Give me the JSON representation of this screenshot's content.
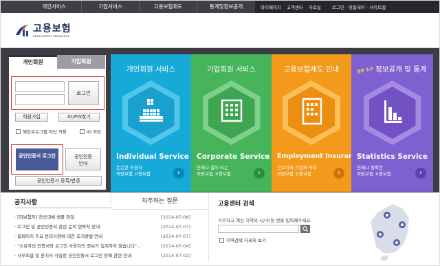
{
  "topnav": {
    "items": [
      "개인서비스",
      "기업서비스",
      "고용보험제도",
      "통계및정보공개"
    ],
    "util": [
      "마이페이지",
      "고객센터",
      "자료실",
      "로그인 · 맞춤제어 · 사이트맵"
    ]
  },
  "logo": {
    "title": "고용보험",
    "subtitle": "EMPLOYMENT INSURANCE"
  },
  "login": {
    "tab_personal": "개인회원",
    "tab_corporate": "기업회원",
    "login_button": "로그인",
    "join_button": "회원가입",
    "find_button": "ID/PW찾기",
    "check_hacking": "해킹프로그램 차단 적용",
    "check_save_id": "ID 저장",
    "cert_login": "공인인증서 로그인",
    "cert_guide": "공인인증 안내",
    "cert_register": "공인인증서 등록/변경"
  },
  "services": [
    {
      "title": "개인회원 서비스",
      "en": "Individual Service",
      "ko": [
        "든든한 후원자",
        "희망보험 고용보험"
      ]
    },
    {
      "title": "기업회원 서비스",
      "en": "Corporate Service",
      "ko": [
        "언제나 힘이 되는",
        "희망보험 고용보험"
      ]
    },
    {
      "title": "고용보험제도 안내",
      "en": "Employment Insurance",
      "ko": [
        "근로자와 기업의 약속",
        "희망보험 고용보험"
      ]
    },
    {
      "title": "정보공개 및 통계",
      "badge": "정부 3.0",
      "en": "Statistics Service",
      "ko": [
        "언제나 정확한",
        "희망보험 고용보험"
      ]
    }
  ],
  "notice": {
    "title": "공지사항",
    "items": [
      {
        "text": "[피보험자] 전산대체 샘플 파일",
        "date": "[2014-07-08]"
      },
      {
        "text": "로그인 및 공인인증서 관련 문의 연락처 안내",
        "date": "[2014-07-07]"
      },
      {
        "text": "홈페이지 주요 문의사항에 대한 조치방법 안내",
        "date": "[2014-07-07]"
      },
      {
        "text": "\"소유하신 인증서와 로그인 사용자의 정보가 일치하지 않습니다\"...",
        "date": "[2014-07-04]"
      },
      {
        "text": "사무조합 및 본지사 사업장 공인인증서 로그인 장애 관련 안내",
        "date": "[2014-07-02]"
      }
    ]
  },
  "faq": {
    "title": "자주하는 질문"
  },
  "center": {
    "title": "고용센터 검색",
    "desc": "거주하고 계신 지역의 시/구/동 명을 입력해주세요.",
    "search_button": "",
    "detail": "지역검색 자세히 보기"
  },
  "colors": {
    "individual": "#17a9d8",
    "corporate": "#45b45a",
    "employment": "#f39a1b",
    "statistics": "#7f60d0"
  }
}
